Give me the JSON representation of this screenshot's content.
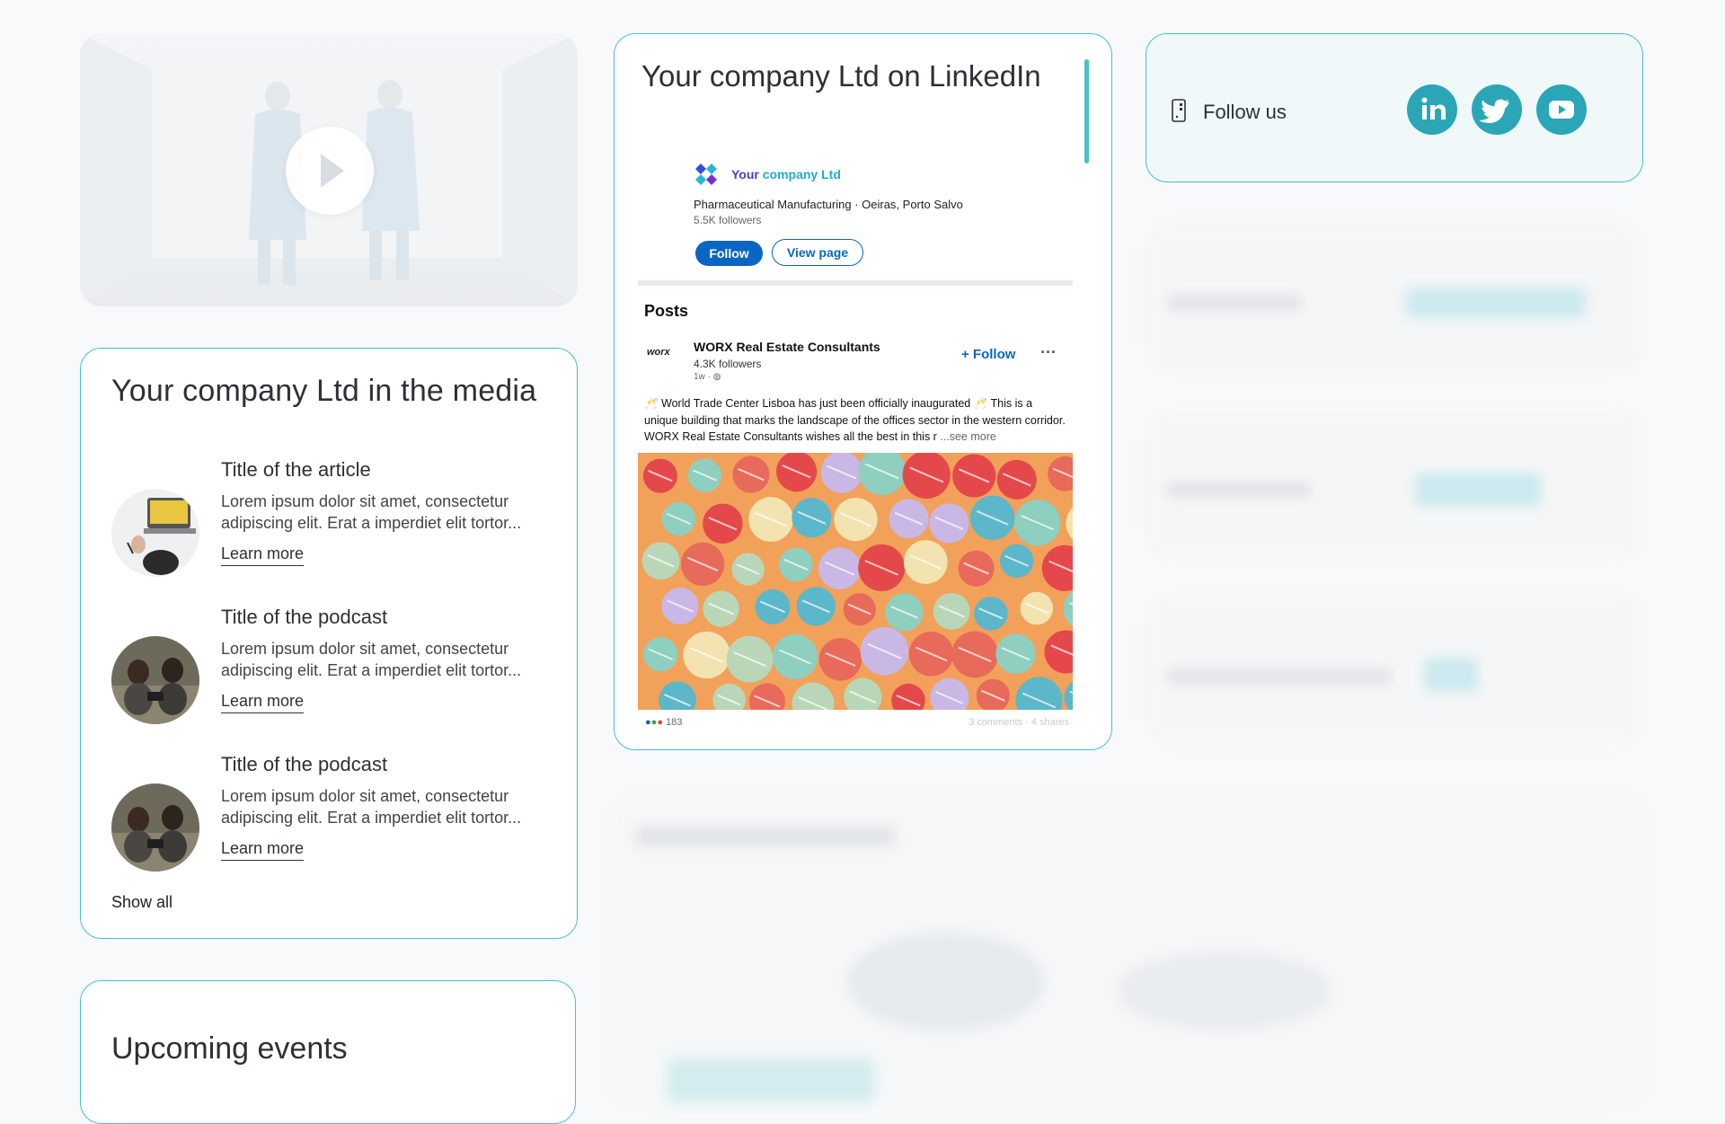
{
  "video": {
    "play_label": "Play"
  },
  "media": {
    "title": "Your company Ltd in the media",
    "items": [
      {
        "title": "Title of the article",
        "desc": "Lorem ipsum dolor sit amet, consectetur adipiscing elit. Erat a imperdiet elit tortor...",
        "link": "Learn more"
      },
      {
        "title": "Title of the podcast",
        "desc": "Lorem ipsum dolor sit amet, consectetur adipiscing elit. Erat a imperdiet elit tortor...",
        "link": "Learn more"
      },
      {
        "title": "Title of the podcast",
        "desc": "Lorem ipsum dolor sit amet, consectetur adipiscing elit. Erat a imperdiet elit tortor...",
        "link": "Learn more"
      }
    ],
    "show_all": "Show all"
  },
  "events": {
    "title": "Upcoming events"
  },
  "linkedin": {
    "title": "Your company Ltd on LinkedIn",
    "company_name_a": "Your",
    "company_name_b": "company Ltd",
    "meta": "Pharmaceutical Manufacturing · Oeiras, Porto Salvo",
    "followers": "5.5K followers",
    "follow_btn": "Follow",
    "view_page_btn": "View page",
    "posts_label": "Posts",
    "post": {
      "logo_text": "worx",
      "author": "WORX Real Estate Consultants",
      "author_followers": "4.3K followers",
      "time": "1w ·",
      "follow": "+ Follow",
      "more": "···",
      "text": "🥂 World Trade Center Lisboa has just been officially inaugurated 🥂 This is a unique building that marks the landscape of the offices sector in the western corridor. WORX Real Estate Consultants wishes all the best in this r",
      "see_more": " ...see more",
      "reactions": "183",
      "stats": "3 comments · 4 shares"
    }
  },
  "follow_us": {
    "label": "Follow us",
    "icons": [
      "linkedin-icon",
      "twitter-icon",
      "youtube-icon"
    ],
    "accent": "#2aa6b6"
  },
  "colors": {
    "border": "#4bbecb",
    "linkedin_blue": "#0a66c2"
  }
}
